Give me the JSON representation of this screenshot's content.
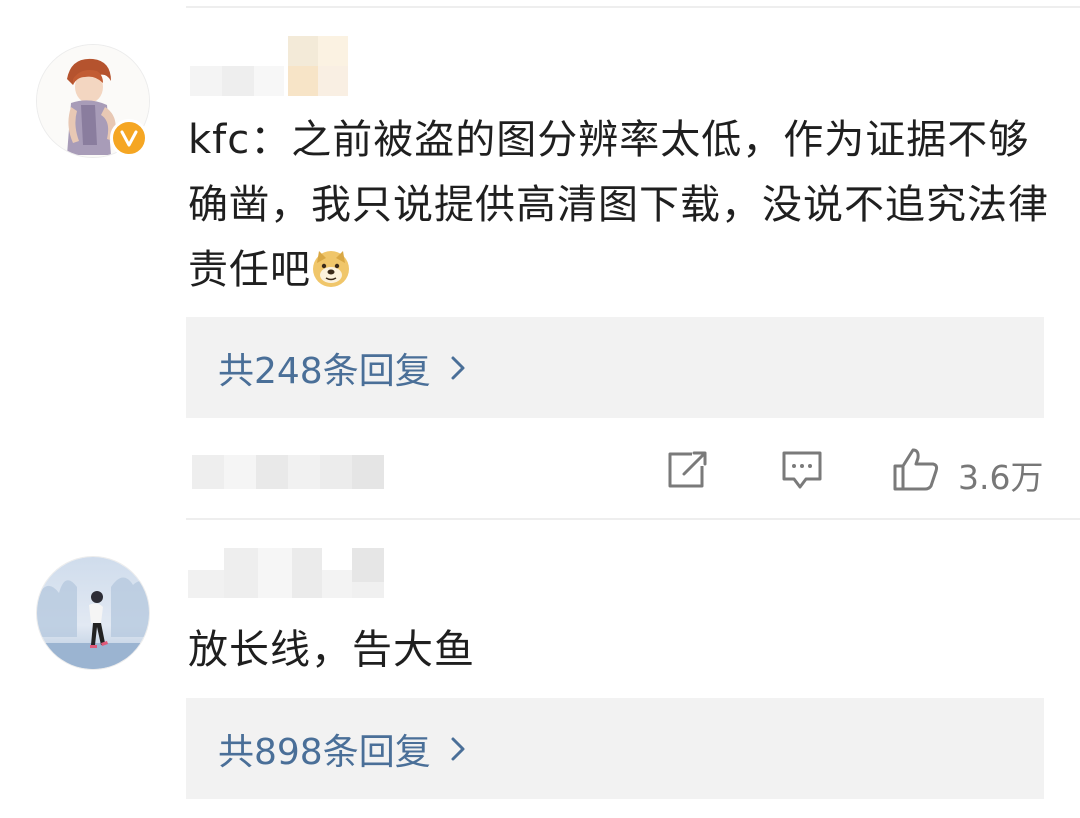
{
  "comments": [
    {
      "text": "kfc：之前被盗的图分辨率太低，作为证据不够确凿，我只说提供高清图下载，没说不追究法律责任吧",
      "emoji": "doge-emoji",
      "verified": true,
      "replies_label": "共248条回复",
      "like_count": "3.6万"
    },
    {
      "text": "放长线，告大鱼",
      "replies_label": "共898条回复"
    }
  ],
  "icons": {
    "share": "share-icon",
    "comment": "comment-icon",
    "like": "thumbs-up-icon",
    "chevron": "chevron-right-icon",
    "verified": "verified-badge-icon"
  },
  "colors": {
    "reply_link": "#4a6f98",
    "reply_bg": "#f2f2f2",
    "verified_badge": "#f5a623",
    "divider": "#eeeeee"
  }
}
